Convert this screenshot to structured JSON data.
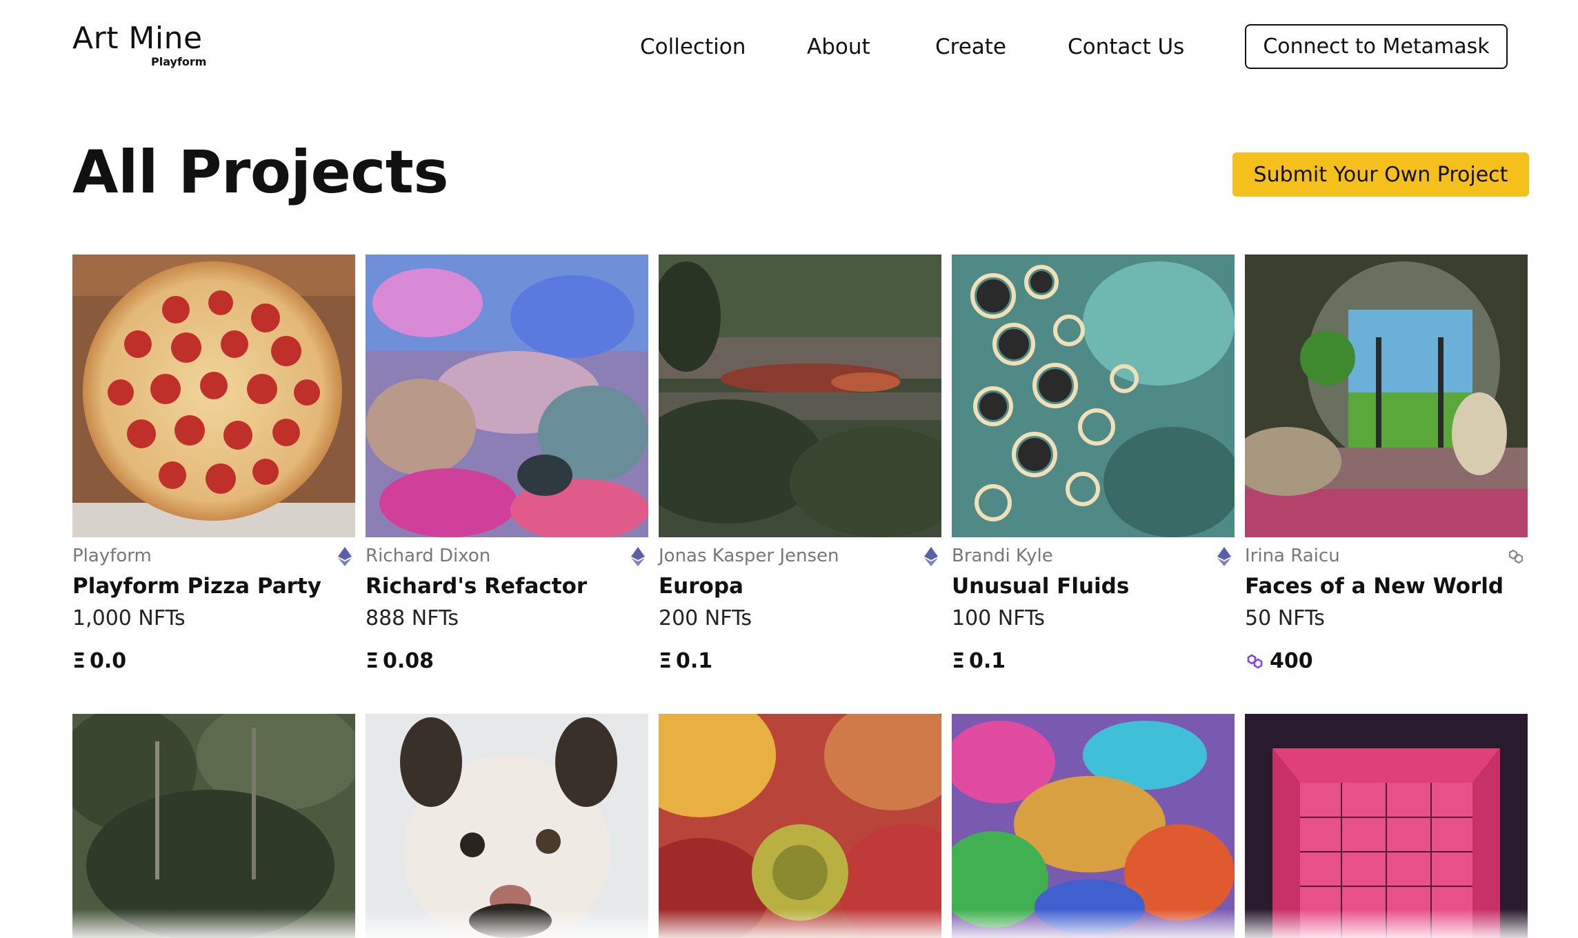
{
  "brand": {
    "title": "Art Mine",
    "subtitle": "Playform"
  },
  "nav": {
    "items": [
      "Collection",
      "About",
      "Create",
      "Contact Us"
    ],
    "connect_label": "Connect to Metamask"
  },
  "page": {
    "title": "All Projects",
    "submit_label": "Submit Your Own Project"
  },
  "colors": {
    "accent": "#f6c01c",
    "ethereum": "#5a5fa8",
    "polygon": "#8247e5"
  },
  "projects": [
    {
      "artist": "Playform",
      "name": "Playform Pizza Party",
      "nfts": "1,000 NFTs",
      "price_symbol": "Ξ",
      "price": "0.0",
      "chain": "ethereum"
    },
    {
      "artist": "Richard Dixon",
      "name": "Richard's Refactor",
      "nfts": "888 NFTs",
      "price_symbol": "Ξ",
      "price": "0.08",
      "chain": "ethereum"
    },
    {
      "artist": "Jonas Kasper Jensen",
      "name": "Europa",
      "nfts": "200 NFTs",
      "price_symbol": "Ξ",
      "price": "0.1",
      "chain": "ethereum"
    },
    {
      "artist": "Brandi Kyle",
      "name": "Unusual Fluids",
      "nfts": "100 NFTs",
      "price_symbol": "Ξ",
      "price": "0.1",
      "chain": "ethereum"
    },
    {
      "artist": "Irina Raicu",
      "name": "Faces of a New World",
      "nfts": "50 NFTs",
      "price_symbol": "",
      "price": "400",
      "chain": "polygon"
    }
  ]
}
